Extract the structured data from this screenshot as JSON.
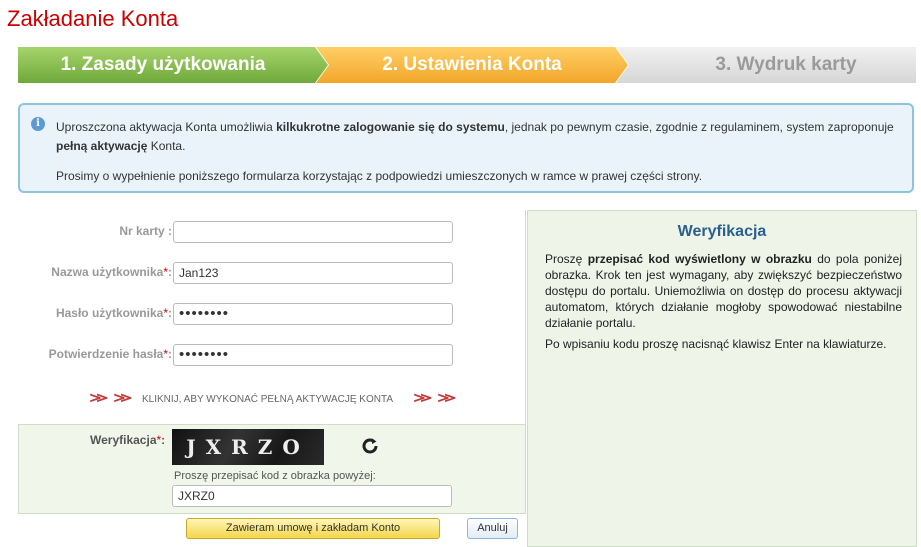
{
  "page_title": "Zakładanie Konta",
  "steps": [
    {
      "label": "1. Zasady użytkowania"
    },
    {
      "label": "2. Ustawienia Konta"
    },
    {
      "label": "3. Wydruk karty"
    }
  ],
  "info": {
    "p1_a": "Uproszczona aktywacja Konta umożliwia ",
    "p1_b": "kilkukrotne zalogowanie się do systemu",
    "p1_c": ", jednak po pewnym czasie, zgodnie z regulaminem, system zaproponuje ",
    "p1_d": "pełną aktywację",
    "p1_e": " Konta.",
    "p2": "Prosimy o wypełnienie poniższego formularza korzystając z podpowiedzi umieszczonych w ramce w prawej części strony."
  },
  "form": {
    "card_label": "Nr karty :",
    "card_value": "",
    "username_label": "Nazwa użytkownika",
    "username_value": "Jan123",
    "password_label": "Hasło użytkownika",
    "password_value": "••••••••",
    "confirm_label": "Potwierdzenie hasła",
    "confirm_value": "••••••••",
    "required_mark": "*",
    "colon": ":"
  },
  "expand": {
    "chevrons": "≫",
    "text": "KLIKNIJ, ABY WYKONAĆ PEŁNĄ AKTYWACJĘ KONTA"
  },
  "verification": {
    "label": "Weryfikacja",
    "captcha_text": "JXRZO",
    "hint": "Proszę przepisać kod z obrazka powyżej:",
    "value": "JXRZ0"
  },
  "buttons": {
    "submit": "Zawieram umowę i zakładam Konto",
    "cancel": "Anuluj"
  },
  "side": {
    "title": "Weryfikacja",
    "p1_a": "Proszę ",
    "p1_b": "przepisać kod wyświetlony w obrazku",
    "p1_c": " do pola poniżej obrazka. Krok ten jest wymagany, aby zwiększyć bezpieczeństwo dostępu do portalu. Uniemożliwia on dostęp do procesu aktywacji automatom, których działanie mogłoby spowodować niestabilne działanie portalu.",
    "p2": "Po wpisaniu kodu proszę nacisnąć klawisz Enter na klawiaturze."
  },
  "colors": {
    "title": "#cc0000",
    "step_active_done": "#79b43f",
    "step_current": "#f5ad2f",
    "step_inactive": "#dddddd",
    "info_border": "#8cc4df",
    "side_title": "#2a5f8f"
  }
}
